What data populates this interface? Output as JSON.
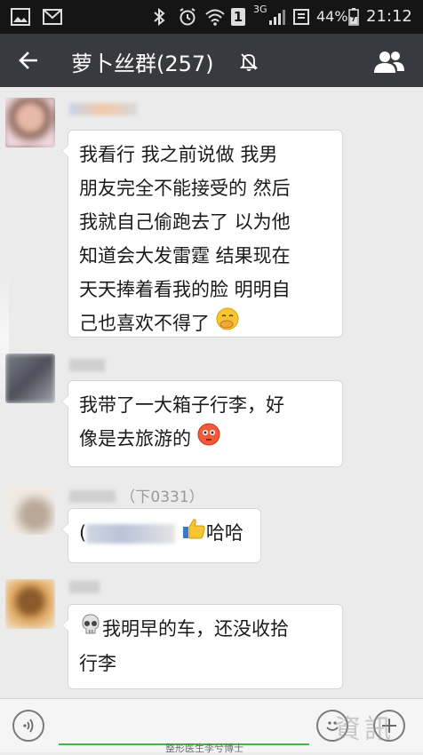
{
  "status_bar": {
    "network": "3G",
    "sim_slot": "1",
    "battery_percent": "44%",
    "time": "21:12",
    "icons": [
      "image-icon",
      "mail-icon",
      "bluetooth-icon",
      "alarm-icon",
      "wifi-icon",
      "sim-icon",
      "signal-icon",
      "battery-saver-icon",
      "battery-icon"
    ]
  },
  "header": {
    "title": "萝卜丝群(257)",
    "back_icon": "back-arrow-icon",
    "mute_icon": "mute-bell-icon",
    "members_icon": "group-members-icon",
    "background": "#393a3f"
  },
  "messages": [
    {
      "sender": "",
      "lines": [
        "我看行 我之前说做 我男",
        "朋友完全不能接受的 然后",
        "我就自己偷跑去了 以为他",
        "知道会大发雷霆 结果现在",
        "天天捧着看我的脸 明明自",
        "己也喜欢不得了"
      ],
      "emoji": "hand-over-mouth-emoji"
    },
    {
      "sender": "",
      "lines": [
        "我带了一大箱子行李，好",
        "像是去旅游的"
      ],
      "emoji": "flushed-face-emoji"
    },
    {
      "sender": "（下0331）",
      "text_prefix": "(",
      "text_suffix": "哈哈",
      "emoji": "thumbs-up-emoji"
    },
    {
      "sender": "",
      "emoji": "skull-emoji",
      "lines": [
        "我明早的车，还没收拾",
        "行李"
      ]
    }
  ],
  "input_bar": {
    "voice_icon": "voice-icon",
    "emoji_icon": "emoji-icon",
    "plus_icon": "plus-icon",
    "accent": "#46b549"
  },
  "watermark": {
    "caption": "整形医生李兮博士"
  }
}
